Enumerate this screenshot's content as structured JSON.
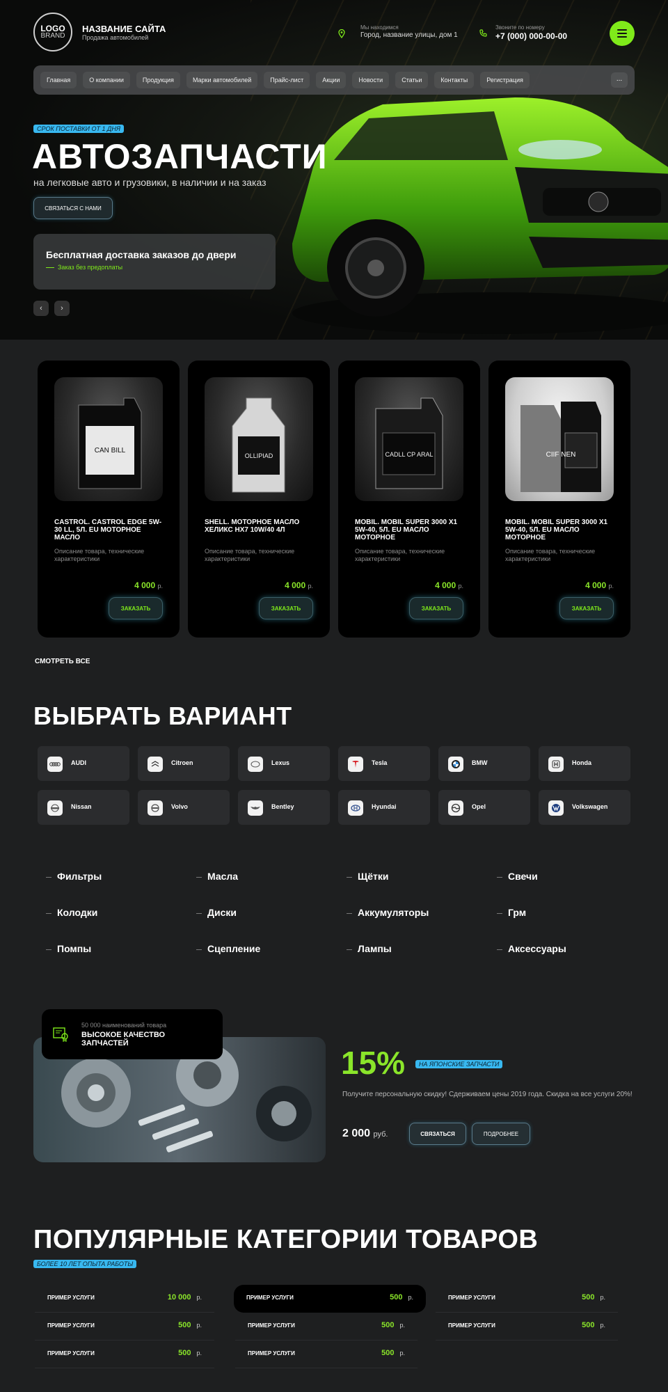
{
  "header": {
    "logo_text": "LOGO",
    "logo_sub": "BRAND",
    "site_name": "НАЗВАНИЕ САЙТА",
    "site_sub": "Продажа автомобилей",
    "location_label": "Мы находимся",
    "location_value": "Город, название улицы, дом 1",
    "phone_label": "Звоните по номеру",
    "phone_value": "+7 (000) 000-00-00"
  },
  "nav": {
    "items": [
      "Главная",
      "О компании",
      "Продукция",
      "Марки автомобилей",
      "Прайс-лист",
      "Акции",
      "Новости",
      "Статьи",
      "Контакты",
      "Регистрация"
    ],
    "more": "..."
  },
  "hero": {
    "badge": "СРОК ПОСТАВКИ ОТ 1 ДНЯ",
    "title": "АВТОЗАПЧАСТИ",
    "subtitle": "на легковые авто и грузовики, в наличии и на заказ",
    "contact_button": "СВЯЗАТЬСЯ С НАМИ",
    "promo_title": "Бесплатная доставка заказов до двери",
    "promo_sub": "Заказ без предоплаты",
    "prev": "‹",
    "next": "›"
  },
  "products": [
    {
      "name": "CASTROL. CASTROL EDGE 5W-30 LL, 5Л. EU МОТОРНОЕ МАСЛО",
      "desc": "Описание товара, технические характеристики",
      "price": "4 000",
      "cur": "р.",
      "button": "ЗАКАЗАТЬ",
      "label": "CAN BILL"
    },
    {
      "name": "SHELL. МОТОРНОЕ МАСЛО ХЕЛИКС HX7 10W/40 4Л",
      "desc": "Описание товара, технические характеристики",
      "price": "4 000",
      "cur": "р.",
      "button": "ЗАКАЗАТЬ",
      "label": "OLLIPIAD"
    },
    {
      "name": "MOBIL. MOBIL SUPER 3000 X1 5W-40, 5Л. EU МАСЛО МОТОРНОЕ",
      "desc": "Описание товара, технические характеристики",
      "price": "4 000",
      "cur": "р.",
      "button": "ЗАКАЗАТЬ",
      "label": "CADLL CP ARAL"
    },
    {
      "name": "MOBIL. MOBIL SUPER 3000 X1 5W-40, 5Л. EU МАСЛО МОТОРНОЕ",
      "desc": "Описание товара, технические характеристики",
      "price": "4 000",
      "cur": "р.",
      "button": "ЗАКАЗАТЬ",
      "label": "CIIF NEN"
    }
  ],
  "see_all": "СМОТРЕТЬ ВСЕ",
  "brands_title": "ВЫБРАТЬ ВАРИАНТ",
  "brands": [
    "AUDI",
    "Citroen",
    "Lexus",
    "Tesla",
    "BMW",
    "Honda",
    "Nissan",
    "Volvo",
    "Bentley",
    "Hyundai",
    "Opel",
    "Volkswagen"
  ],
  "categories": [
    "Фильтры",
    "Масла",
    "Щётки",
    "Свечи",
    "Колодки",
    "Диски",
    "Аккумуляторы",
    "Грм",
    "Помпы",
    "Сцепление",
    "Лампы",
    "Аксессуары"
  ],
  "discount": {
    "quality_sub": "50 000 наименований товара",
    "quality_title": "ВЫСОКОЕ КАЧЕСТВО ЗАПЧАСТЕЙ",
    "percent": "15%",
    "badge": "НА ЯПОНСКИЕ ЗАПЧАСТИ",
    "text": "Получите персональную скидку! Сдерживаем цены 2019 года. Скидка на все услуги 20%!",
    "price": "2 000",
    "cur": "руб.",
    "btn_contact": "СВЯЗАТЬСЯ",
    "btn_more": "ПОДРОБНЕЕ"
  },
  "popular": {
    "title": "ПОПУЛЯРНЫЕ КАТЕГОРИИ ТОВАРОВ",
    "badge": "БОЛЕЕ 10 ЛЕТ ОПЫТА РАБОТЫ",
    "cols": [
      [
        {
          "name": "ПРИМЕР УСЛУГИ",
          "price": "10 000",
          "cur": "р."
        },
        {
          "name": "ПРИМЕР УСЛУГИ",
          "price": "500",
          "cur": "р."
        },
        {
          "name": "ПРИМЕР УСЛУГИ",
          "price": "500",
          "cur": "р."
        }
      ],
      [
        {
          "name": "ПРИМЕР УСЛУГИ",
          "price": "500",
          "cur": "р."
        },
        {
          "name": "ПРИМЕР УСЛУГИ",
          "price": "500",
          "cur": "р."
        },
        {
          "name": "ПРИМЕР УСЛУГИ",
          "price": "500",
          "cur": "р."
        }
      ],
      [
        {
          "name": "ПРИМЕР УСЛУГИ",
          "price": "500",
          "cur": "р."
        },
        {
          "name": "ПРИМЕР УСЛУГИ",
          "price": "500",
          "cur": "р."
        }
      ]
    ]
  },
  "colors": {
    "accent": "#7fea1a",
    "badge": "#38b8f0",
    "background": "#1e1f20",
    "card": "#000000"
  }
}
